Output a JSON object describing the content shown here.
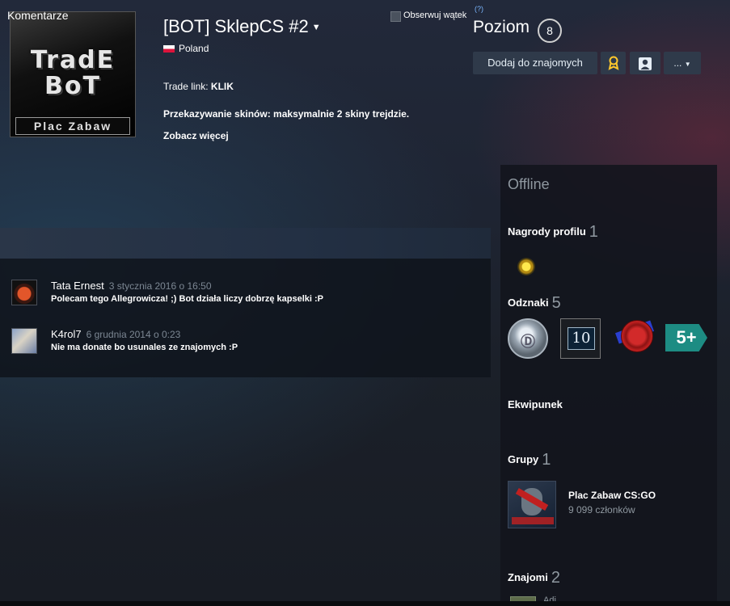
{
  "profile": {
    "avatar_text_line1": "TradE",
    "avatar_text_line2": "BoT",
    "avatar_text_line3": "Plac Zabaw",
    "persona_name": "[BOT] SklepCS #2",
    "country": "Poland",
    "trade_link_label": "Trade link:",
    "trade_link_value": "KLIK",
    "summary_line": "Przekazywanie skinów: maksymalnie 2 skiny trejdzie.",
    "view_more": "Zobacz więcej"
  },
  "level": {
    "label": "Poziom",
    "value": "8"
  },
  "actions": {
    "add_friend": "Dodaj do znajomych",
    "more": "..."
  },
  "comments": {
    "title": "Komentarze",
    "subscribe_label": "Obserwuj wątek",
    "help": "(?)",
    "items": [
      {
        "author": "Tata Ernest",
        "time": "3 stycznia 2016 o 16:50",
        "text": "Polecam tego Allegrowicza! ;) Bot działa liczy dobrzę kapselki :P"
      },
      {
        "author": "K4rol7",
        "time": "6 grudnia 2014 o 0:23",
        "text": "Nie ma donate bo usunales ze znajomych :P"
      }
    ]
  },
  "sidebar": {
    "status": "Offline",
    "awards_label": "Nagrody profilu",
    "awards_count": "1",
    "badges_label": "Odznaki",
    "badges_count": "5",
    "badge_level_text": "10",
    "badge_years_text": "5+",
    "inventory_label": "Ekwipunek",
    "groups_label": "Grupy",
    "groups_count": "1",
    "group_name": "Plac Zabaw CS:GO",
    "group_members": "9 099 członków",
    "friends_label": "Znajomi",
    "friends_count": "2",
    "friend_peek_name": "Adi"
  },
  "colors": {
    "accent_award": "#ffc82c",
    "badge_years": "#1d8c83",
    "offline": "#8f98a0"
  }
}
